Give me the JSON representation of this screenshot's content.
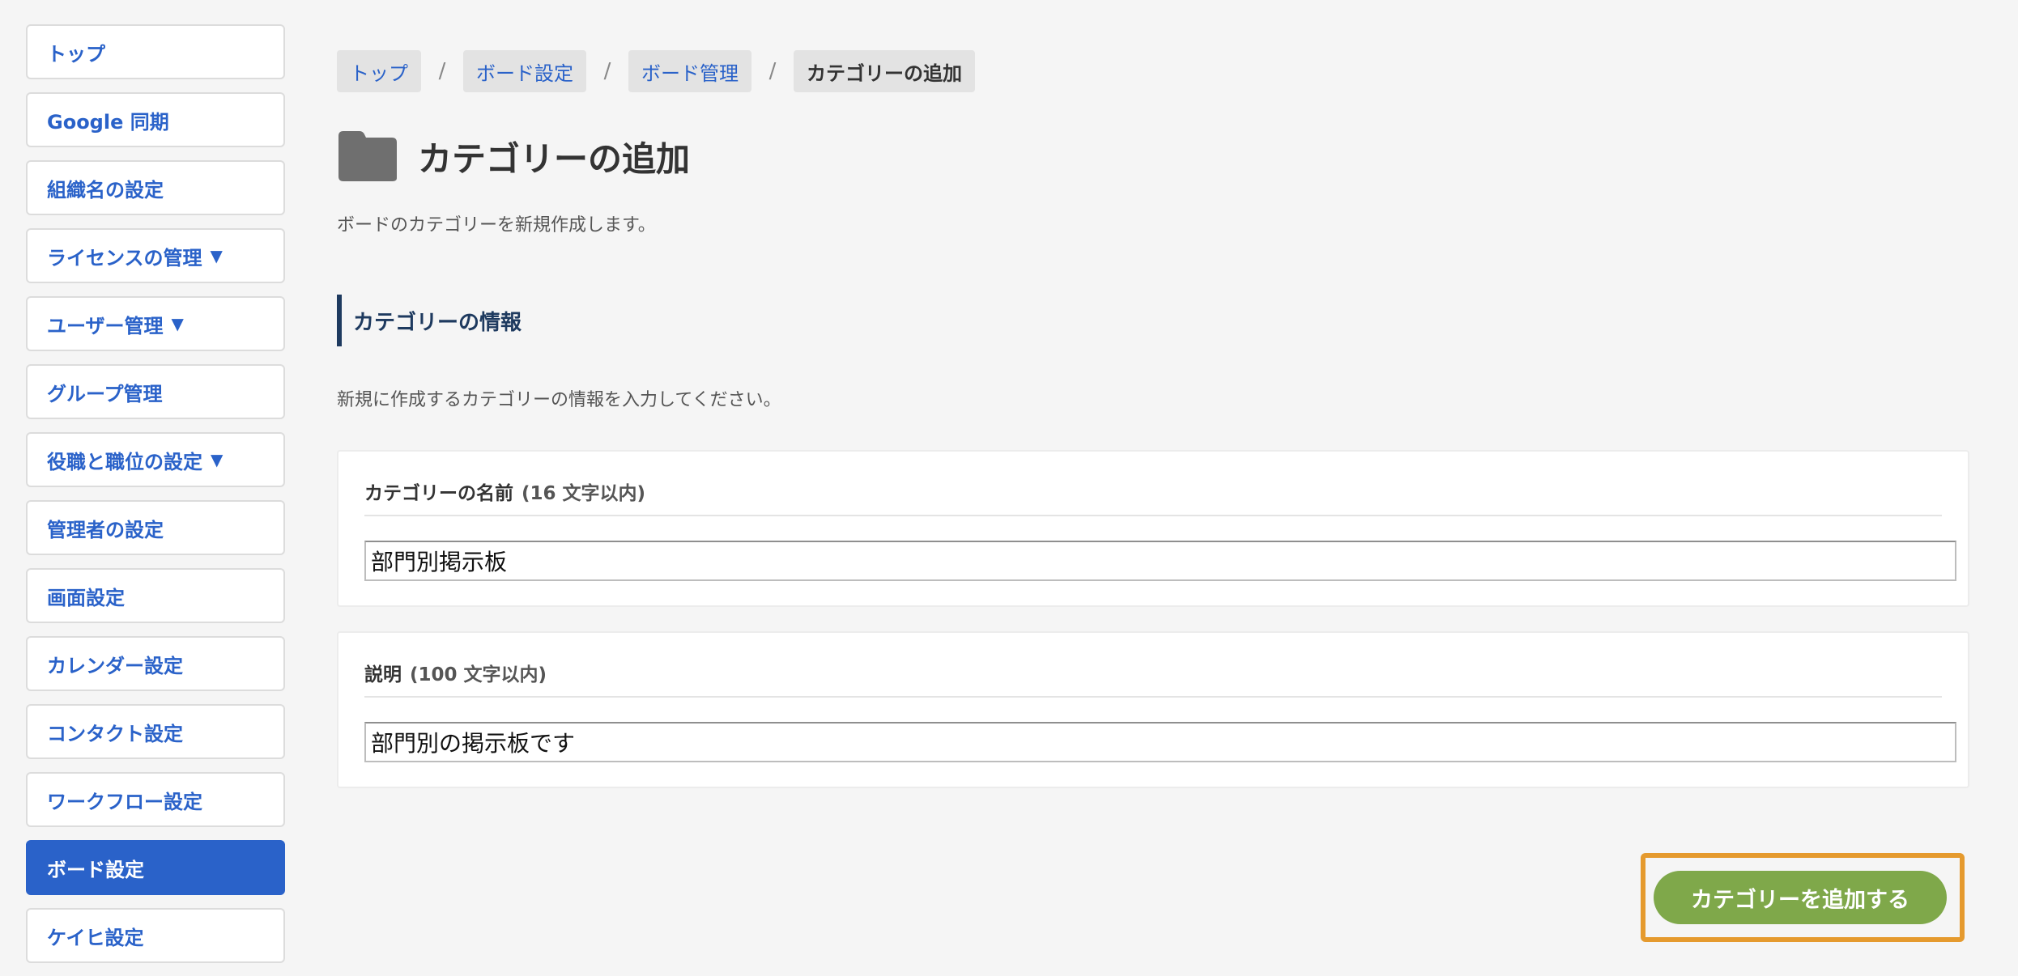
{
  "sidebar": {
    "items": [
      {
        "label": "トップ",
        "caret": ""
      },
      {
        "label": "Google 同期",
        "caret": ""
      },
      {
        "label": "組織名の設定",
        "caret": ""
      },
      {
        "label": "ライセンスの管理",
        "caret": "▼"
      },
      {
        "label": "ユーザー管理",
        "caret": "▼"
      },
      {
        "label": "グループ管理",
        "caret": ""
      },
      {
        "label": "役職と職位の設定",
        "caret": "▼"
      },
      {
        "label": "管理者の設定",
        "caret": ""
      },
      {
        "label": "画面設定",
        "caret": ""
      },
      {
        "label": "カレンダー設定",
        "caret": ""
      },
      {
        "label": "コンタクト設定",
        "caret": ""
      },
      {
        "label": "ワークフロー設定",
        "caret": ""
      },
      {
        "label": "ボード設定",
        "caret": ""
      },
      {
        "label": "ケイヒ設定",
        "caret": ""
      }
    ],
    "active_label": "ボード設定"
  },
  "breadcrumb": {
    "items": [
      "トップ",
      "ボード設定",
      "ボード管理",
      "カテゴリーの追加"
    ],
    "separator": "/"
  },
  "page": {
    "icon": "folder-icon",
    "title": "カテゴリーの追加",
    "description": "ボードのカテゴリーを新規作成します。"
  },
  "section": {
    "title": "カテゴリーの情報",
    "description": "新規に作成するカテゴリーの情報を入力してください。"
  },
  "form": {
    "name": {
      "label": "カテゴリーの名前",
      "hint": "(16 文字以内)",
      "value": "部門別掲示板"
    },
    "description": {
      "label": "説明",
      "hint": "(100 文字以内)",
      "value": "部門別の掲示板です"
    }
  },
  "submit": {
    "label": "カテゴリーを追加する"
  },
  "colors": {
    "link": "#2a62c9",
    "active_nav": "#2a62c9",
    "submit": "#7fa84a",
    "highlight": "#e59a2e",
    "section_accent": "#1e3a5f"
  }
}
